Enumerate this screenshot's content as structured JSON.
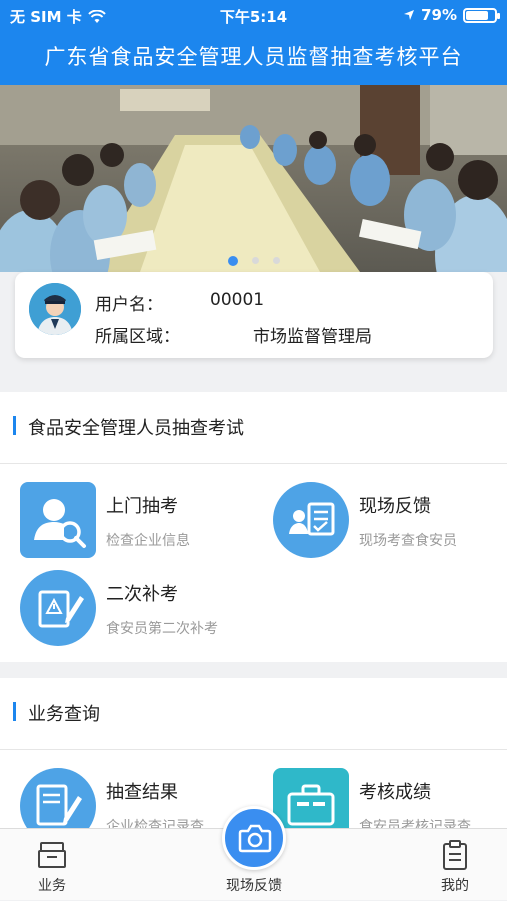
{
  "status_bar": {
    "carrier": "无 SIM 卡",
    "time": "下午5:14",
    "battery_pct_text": "79%",
    "battery_level": 0.79
  },
  "header": {
    "title": "广东省食品安全管理人员监督抽查考核平台"
  },
  "banner": {
    "page_count": 3,
    "active_index": 0
  },
  "user": {
    "username_label": "用户名：",
    "username_value": "00001",
    "region_label": "所属区域：",
    "region_value": "市场监督管理局"
  },
  "exam_section": {
    "title": "食品安全管理人员抽查考试",
    "tiles": [
      {
        "name": "上门抽考",
        "desc": "检查企业信息",
        "icon": "user-search-icon"
      },
      {
        "name": "现场反馈",
        "desc": "现场考查食安员",
        "icon": "feedback-form-icon"
      },
      {
        "name": "二次补考",
        "desc": "食安员第二次补考",
        "icon": "edit-warning-icon"
      }
    ]
  },
  "query_section": {
    "title": "业务查询",
    "tiles": [
      {
        "name": "抽查结果",
        "desc": "企业检查记录查",
        "icon": "document-pen-icon"
      },
      {
        "name": "考核成绩",
        "desc": "食安员考核记录查",
        "icon": "briefcase-icon"
      }
    ]
  },
  "tabbar": {
    "tabs": [
      {
        "label": "业务",
        "icon": "inbox-tray-icon"
      },
      {
        "label": "现场反馈",
        "icon": "camera-icon"
      },
      {
        "label": "我的",
        "icon": "clipboard-icon"
      }
    ]
  },
  "colors": {
    "primary": "#1c86ee",
    "icon_blue": "#4ea3e6",
    "icon_teal": "#2fb8c9"
  }
}
